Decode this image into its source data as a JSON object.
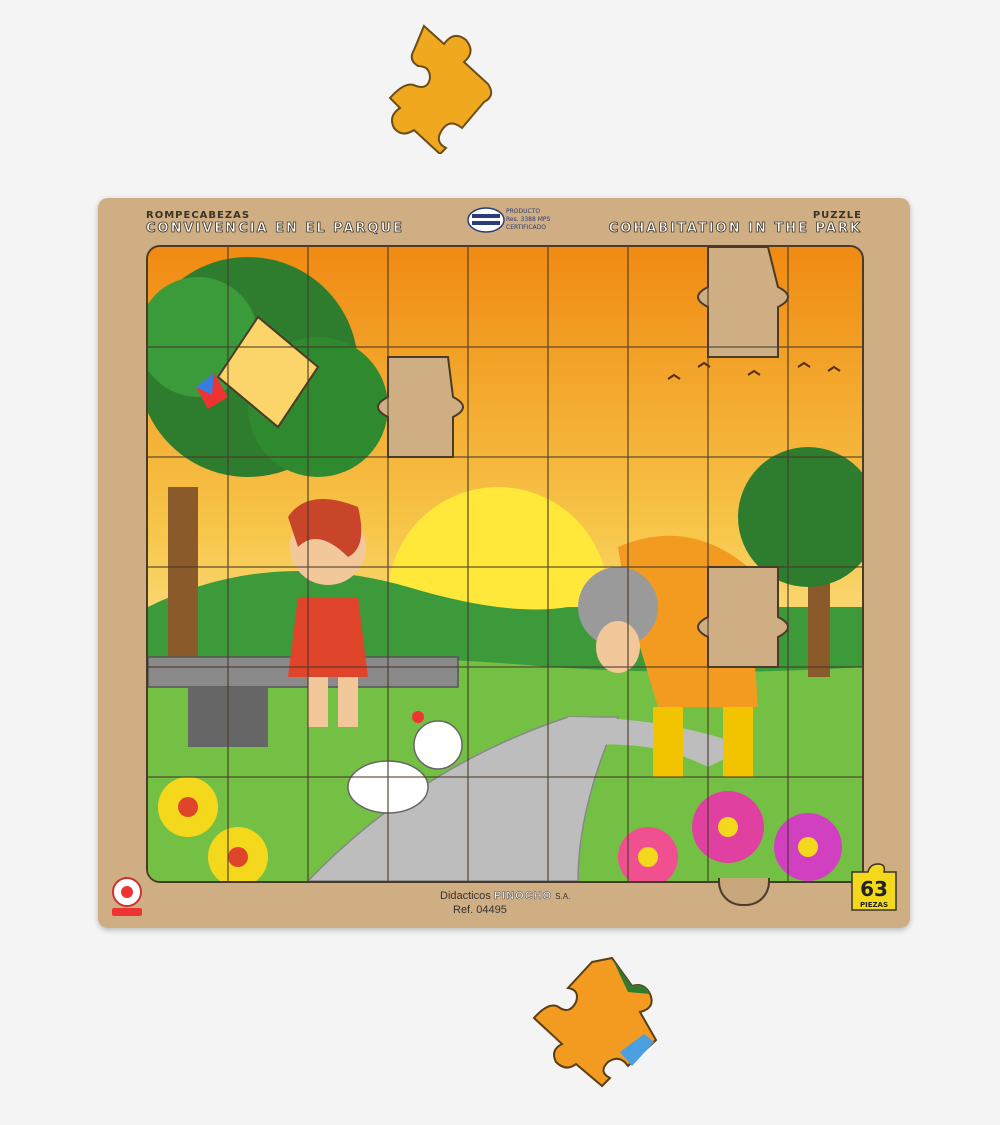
{
  "board": {
    "title_es_small": "ROMPECABEZAS",
    "title_es": "CONVIVENCIA EN EL PARQUE",
    "title_en_small": "PUZZLE",
    "title_en": "COHABITATION IN THE PARK",
    "cert_line1": "PRODUCTO",
    "cert_line2": "Res. 3388 MPS",
    "cert_line3": "CERTIFICADO",
    "brand_prefix": "Didacticos",
    "brand_name": "PINOCHO",
    "brand_suffix": "S.A.",
    "ref": "Ref. 04495",
    "piece_count": "63",
    "piece_word": "PIEZAS"
  },
  "colors": {
    "background": "#f4f4f4",
    "board_wood": "#cfae84",
    "sky_top": "#f29a1c",
    "sky_bottom": "#fde9a0",
    "grass": "#6fbf3a",
    "path": "#b9b9b9",
    "outline": "#3c3326"
  },
  "icons": [
    "kite-icon",
    "birds-icon",
    "sun-icon",
    "flower-icon",
    "poodle-icon",
    "pinocchio-logo"
  ]
}
